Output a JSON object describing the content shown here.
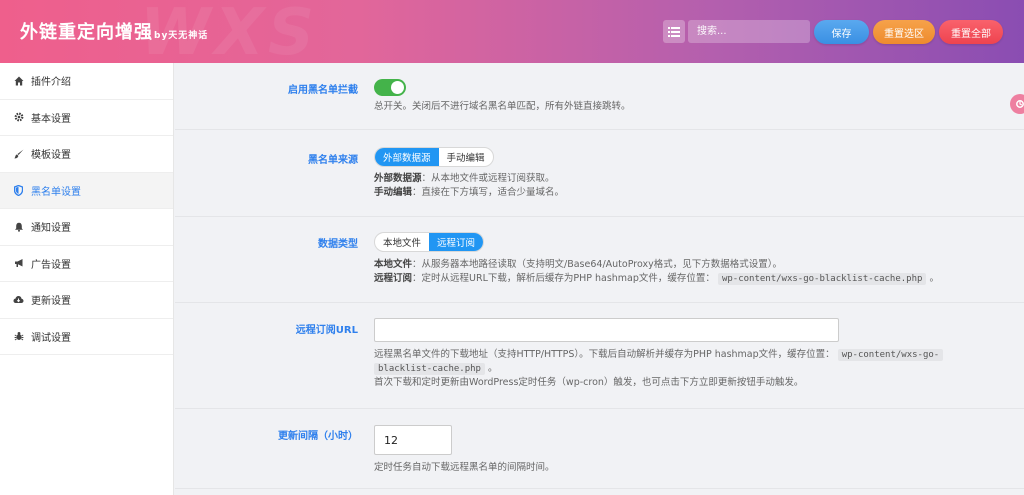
{
  "header": {
    "title": "外链重定向增强",
    "by": "by天无神话",
    "watermark": "WXS",
    "search_placeholder": "搜索...",
    "save_label": "保存",
    "reset_section_label": "重置选区",
    "reset_all_label": "重置全部"
  },
  "sidebar": {
    "items": [
      {
        "label": "插件介绍",
        "icon": "home-icon"
      },
      {
        "label": "基本设置",
        "icon": "gear-icon"
      },
      {
        "label": "模板设置",
        "icon": "brush-icon"
      },
      {
        "label": "黑名单设置",
        "icon": "shield-icon",
        "active": true
      },
      {
        "label": "通知设置",
        "icon": "bell-icon"
      },
      {
        "label": "广告设置",
        "icon": "megaphone-icon"
      },
      {
        "label": "更新设置",
        "icon": "cloud-download-icon"
      },
      {
        "label": "调试设置",
        "icon": "bug-icon"
      }
    ]
  },
  "main": {
    "enable": {
      "label": "启用黑名单拦截",
      "value": true,
      "desc": "总开关。关闭后不进行域名黑名单匹配，所有外链直接跳转。"
    },
    "source": {
      "label": "黑名单来源",
      "options": [
        "外部数据源",
        "手动编辑"
      ],
      "selected": "外部数据源",
      "desc1_key": "外部数据源",
      "desc1": "：从本地文件或远程订阅获取。",
      "desc2_key": "手动编辑",
      "desc2": "：直接在下方填写，适合少量域名。"
    },
    "data_type": {
      "label": "数据类型",
      "options": [
        "本地文件",
        "远程订阅"
      ],
      "selected": "远程订阅",
      "desc1_key": "本地文件",
      "desc1": "：从服务器本地路径读取（支持明文/Base64/AutoProxy格式，见下方数据格式设置）。",
      "desc2_key": "远程订阅",
      "desc2": "：定时从远程URL下载，解析后缓存为PHP hashmap文件，缓存位置：",
      "desc2_code": "wp-content/wxs-go-blacklist-cache.php",
      "desc2_end": "。"
    },
    "remote_url": {
      "label": "远程订阅URL",
      "value": "",
      "desc1": "远程黑名单文件的下载地址（支持HTTP/HTTPS）。下载后自动解析并缓存为PHP hashmap文件，缓存位置：",
      "desc1_code_a": "wp-content/wxs-go-",
      "desc1_code_b": "blacklist-cache.php",
      "desc1_end": "。",
      "desc2": "首次下载和定时更新由WordPress定时任务（wp-cron）触发，也可点击下方立即更新按钮手动触发。"
    },
    "interval": {
      "label": "更新间隔（小时）",
      "value": "12",
      "desc": "定时任务自动下载远程黑名单的间隔时间。"
    }
  },
  "colors": {
    "accent": "#2f80ed",
    "toggle_on": "#44b34a",
    "segment_on": "#2196f3",
    "save": "#4a9ee9",
    "reset_section": "#f29a3c",
    "reset_all": "#f2525d"
  }
}
